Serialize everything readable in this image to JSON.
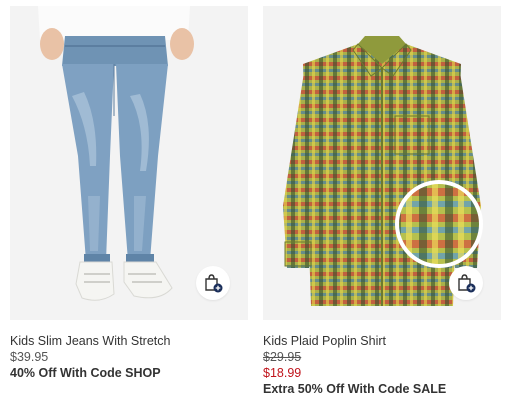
{
  "products": [
    {
      "name": "Kids Slim Jeans With Stretch",
      "price": "$39.95",
      "promo": "40% Off With Code SHOP",
      "bag_icon": "shopping-bag-add-icon"
    },
    {
      "name": "Kids Plaid Poplin Shirt",
      "original_price": "$29.95",
      "sale_price": "$18.99",
      "promo": "Extra 50% Off With Code SALE",
      "bag_icon": "shopping-bag-add-icon"
    }
  ],
  "colors": {
    "sale_price": "#c0131b",
    "image_bg": "#f3f3f3",
    "bag_badge": "#1a2e5a"
  }
}
